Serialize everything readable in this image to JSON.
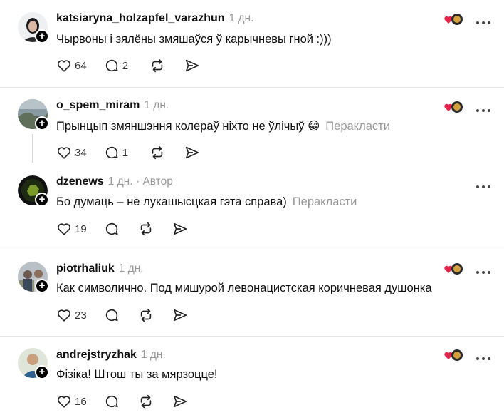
{
  "posts": [
    {
      "username": "katsiaryna_holzapfel_varazhun",
      "time": "1 дн.",
      "text": "Чырвоны і зялёны змяшаўся ў карычневы гной :)))",
      "likes": "64",
      "replies": "2"
    },
    {
      "username": "o_spem_miram",
      "time": "1 дн.",
      "text": "Прынцып змяншэння колераў ніхто не ўлічыў 😁",
      "translate": "Перакласти",
      "likes": "34",
      "replies": "1"
    },
    {
      "username": "dzenews",
      "time": "1 дн.",
      "author_badge": "· Автор",
      "text": "Бо думаць – не лукашысцкая гэта справа)",
      "translate": "Перакласти",
      "likes": "19"
    },
    {
      "username": "piotrhaliuk",
      "time": "1 дн.",
      "text": "Как символично. Под мишурой левонацистская коричневая душонка",
      "likes": "23"
    },
    {
      "username": "andrejstryzhak",
      "time": "1 дн.",
      "text": "Фізіка! Штош ты за мярзоцце!",
      "likes": "16"
    }
  ],
  "icons": {
    "like": "heart-icon",
    "reply": "comment-icon",
    "repost": "repost-icon",
    "share": "send-icon",
    "more": "more-icon",
    "follow": "plus-icon"
  },
  "colors": {
    "text": "#101010",
    "muted": "#999999",
    "divider": "#e5e5e5",
    "heart_react": "#e0244c"
  }
}
